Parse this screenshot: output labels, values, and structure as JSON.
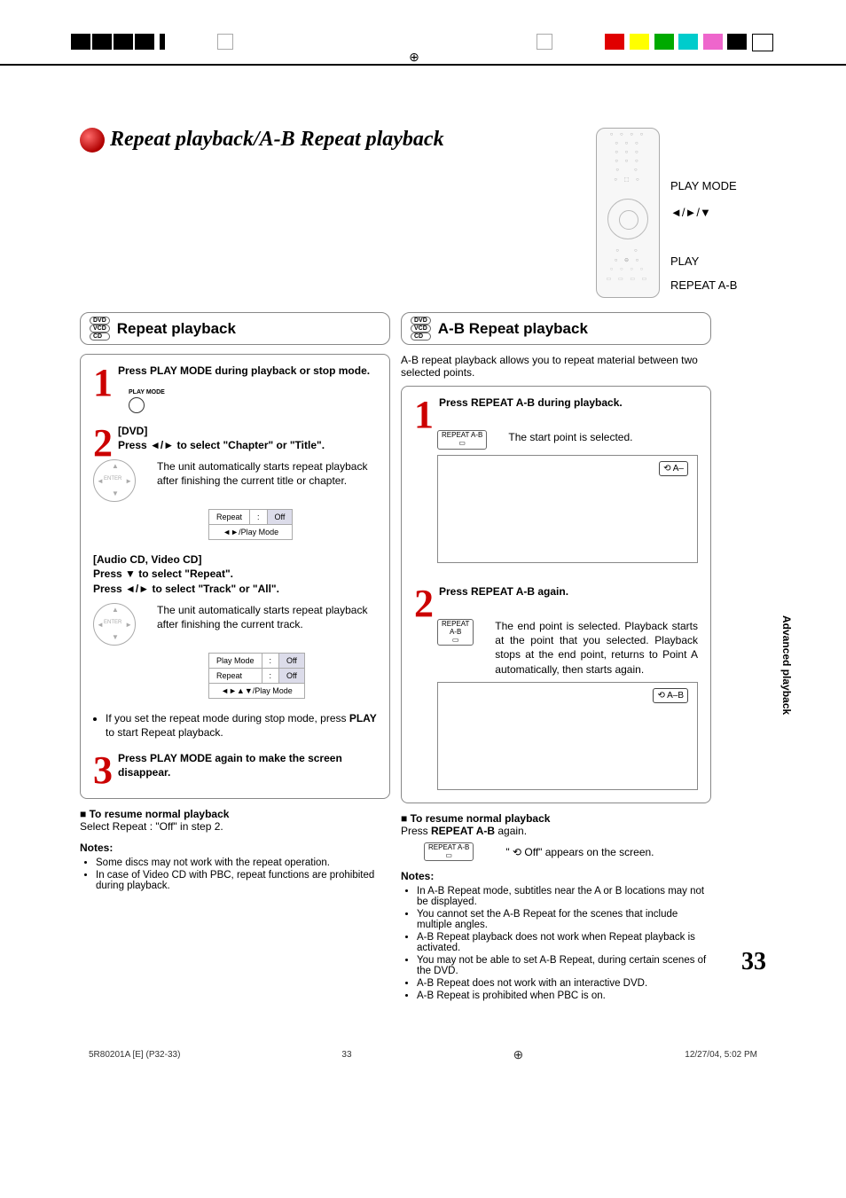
{
  "pageTitle": "Repeat playback/A-B Repeat playback",
  "remoteLabels": {
    "playMode": "PLAY MODE",
    "arrows": "◄/►/▼",
    "play": "PLAY",
    "repeatAB": "REPEAT A-B"
  },
  "discLabels": {
    "dvd": "DVD",
    "vcd": "VCD",
    "cd": "CD"
  },
  "left": {
    "heading": "Repeat playback",
    "step1": "Press PLAY MODE during playback or stop mode.",
    "playModeBtn": "PLAY MODE",
    "step2Title": "[DVD]",
    "step2Instr": "Press ◄/► to select \"Chapter\" or \"Title\".",
    "step2Desc": "The unit automatically starts repeat playback after finishing the current title or chapter.",
    "osd1": {
      "r1c1": "Repeat",
      "r1c2": ":",
      "r1c3": "Off",
      "r2": "◄►/Play Mode"
    },
    "step2bTitle": "[Audio CD, Video CD]",
    "step2bLine1": "Press ▼ to select \"Repeat\".",
    "step2bLine2": "Press ◄/► to select \"Track\" or \"All\".",
    "step2bDesc": "The unit automatically starts repeat playback after finishing the current track.",
    "osd2": {
      "r1c1": "Play Mode",
      "r1c2": ":",
      "r1c3": "Off",
      "r2c1": "Repeat",
      "r2c3": "Off",
      "r3": "◄►▲▼/Play Mode"
    },
    "bulletNote": "If you set the repeat mode during stop mode, press PLAY to start Repeat playback.",
    "step3": "Press PLAY MODE again to make the screen disappear.",
    "resumeH": "To resume normal playback",
    "resumeT": "Select Repeat : \"Off\" in step 2.",
    "notesH": "Notes:",
    "notes": [
      "Some discs may not work with the repeat operation.",
      "In case of Video CD with PBC, repeat functions are prohibited during playback."
    ]
  },
  "right": {
    "heading": "A-B Repeat playback",
    "intro": "A-B repeat playback allows you to repeat material between two selected points.",
    "step1": "Press REPEAT A-B during playback.",
    "step1Btn": "REPEAT A-B",
    "step1Desc": "The start point is selected.",
    "badge1": "⟲ A–",
    "step2": "Press REPEAT A-B again.",
    "step2Desc": "The end point is selected. Playback starts at the point that you selected. Playback stops at the end point, returns to Point A automatically, then starts again.",
    "badge2": "⟲ A–B",
    "resumeH": "To resume normal playback",
    "resumeLine": "Press REPEAT A-B again.",
    "resumeOff": "\" ⟲ Off\" appears on the screen.",
    "notesH": "Notes:",
    "notes": [
      "In A-B Repeat mode, subtitles near the A or B locations may not be displayed.",
      "You cannot set the A-B Repeat for the scenes that include multiple angles.",
      "A-B Repeat playback does not work when Repeat playback is activated.",
      "You may not be able to set A-B Repeat, during certain scenes of the DVD.",
      "A-B Repeat does not work with an interactive DVD.",
      "A-B Repeat is prohibited when PBC is on."
    ]
  },
  "sideTab": "Advanced playback",
  "pageNumber": "33",
  "footer": {
    "left": "5R80201A [E] (P32-33)",
    "center": "33",
    "right": "12/27/04, 5:02 PM"
  }
}
